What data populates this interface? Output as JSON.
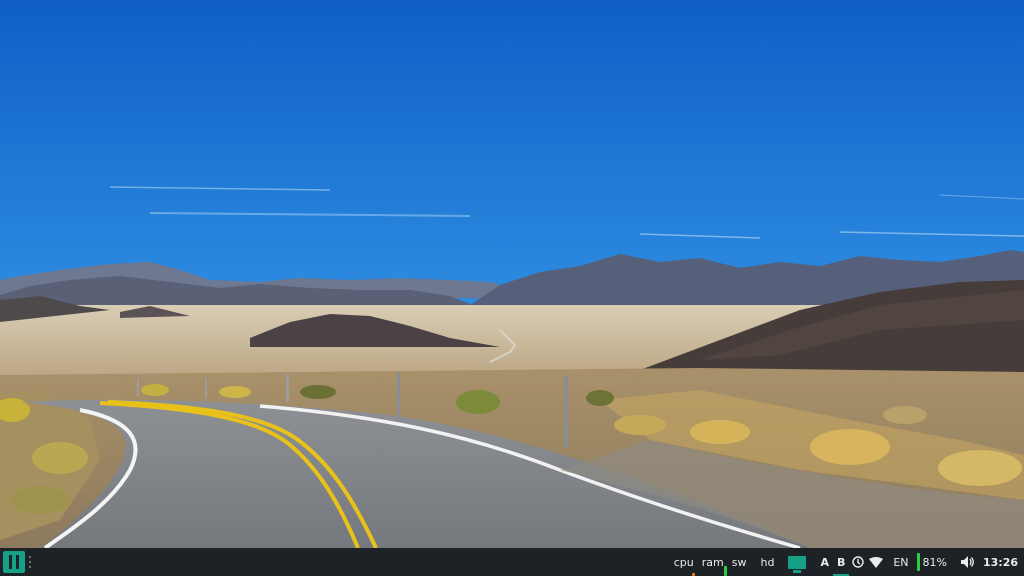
{
  "panel": {
    "system_monitors": [
      {
        "label": "cpu",
        "bar_color": "#e67e22",
        "level": 0.15
      },
      {
        "label": "ram",
        "bar_color": "#2ecc40",
        "level": 0.45
      },
      {
        "label": "sw",
        "bar_color": "#e67e22",
        "level": 0.0
      },
      {
        "label": "hd",
        "bar_color": "#2ecc40",
        "level": 0.0
      }
    ],
    "keyboard_indicators": [
      {
        "label": "A",
        "active": false
      },
      {
        "label": "B",
        "active": true
      }
    ],
    "language": "EN",
    "battery": "81%",
    "clock": "13:26"
  },
  "icons": {
    "menu": "app-menu-icon",
    "window": "window-list-icon",
    "network": "wifi-icon",
    "update": "update-icon",
    "volume": "speaker-icon"
  },
  "colors": {
    "accent": "#16a085",
    "panel_bg": "#1d2226",
    "sky_top": "#1062c9",
    "sky_bottom": "#7ec6f3"
  }
}
